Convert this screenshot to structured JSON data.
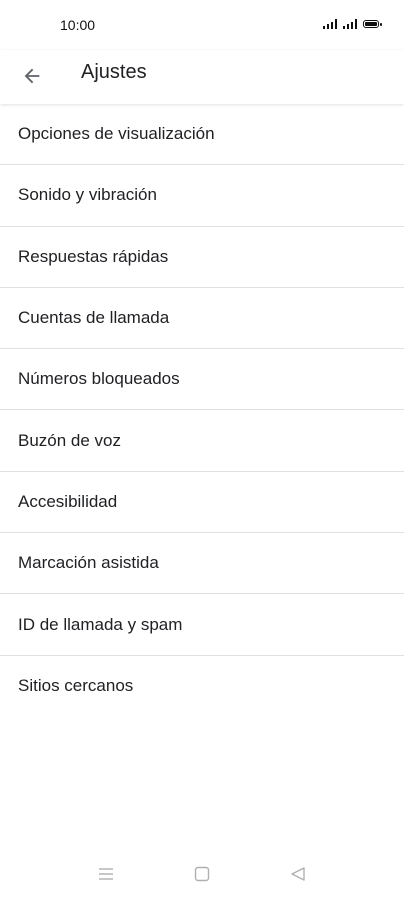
{
  "status_bar": {
    "time": "10:00"
  },
  "app_bar": {
    "title": "Ajustes",
    "back_icon": "arrow-back-icon"
  },
  "settings": {
    "items": [
      {
        "label": "Opciones de visualización"
      },
      {
        "label": "Sonido y vibración"
      },
      {
        "label": "Respuestas rápidas"
      },
      {
        "label": "Cuentas de llamada"
      },
      {
        "label": "Números bloqueados"
      },
      {
        "label": "Buzón de voz"
      },
      {
        "label": "Accesibilidad"
      },
      {
        "label": "Marcación asistida"
      },
      {
        "label": "ID de llamada y spam"
      },
      {
        "label": "Sitios cercanos"
      }
    ]
  },
  "nav_bar": {
    "icons": [
      "menu-icon",
      "home-icon",
      "back-triangle-icon"
    ]
  },
  "colors": {
    "text": "#202124",
    "divider": "#e0e0e0",
    "nav_icon": "#b0b0b0"
  }
}
